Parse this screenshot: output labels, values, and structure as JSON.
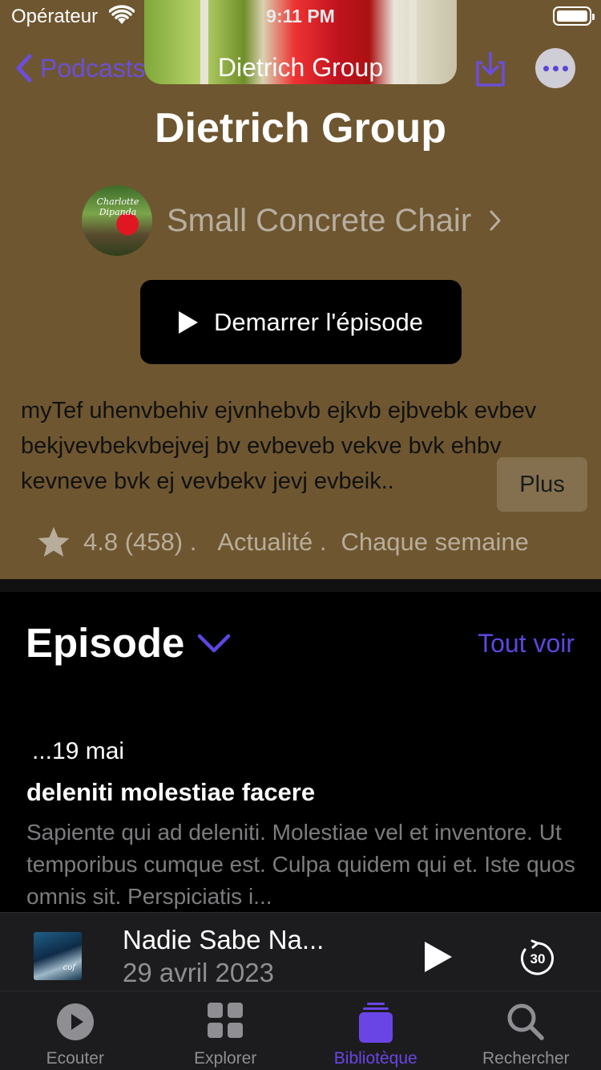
{
  "status_bar": {
    "carrier": "Opérateur",
    "time": "9:11 PM"
  },
  "nav": {
    "back_label": "Podcasts",
    "title": "Dietrich Group"
  },
  "podcast": {
    "title": "Dietrich Group",
    "author": "Small Concrete Chair",
    "avatar_script": "Charlotte Dipanda",
    "start_button": "Demarrer l'épisode",
    "description": "myTef uhenvbehiv ejvnhebvb ejkvb ejbvebk evbev bekjvevbekvbejvej bv evbeveb vekve bvk ehbv kevneve bvk ej vevbekv jevj evbeik..",
    "more_label": "Plus",
    "rating": "4.8 (458) .",
    "category": "Actualité .",
    "frequency": "Chaque semaine"
  },
  "episodes": {
    "header": "Episode",
    "see_all": "Tout voir",
    "items": [
      {
        "date": "...19 mai",
        "title": "deleniti molestiae facere",
        "description": "Sapiente qui ad deleniti. Molestiae vel et inventore. Ut temporibus cumque est. Culpa quidem qui et. Iste quos omnis sit. Perspiciatis i..."
      }
    ]
  },
  "mini_player": {
    "title": "Nadie Sabe Na...",
    "date": "29 avril 2023",
    "skip_label": "30",
    "art_script": "cof"
  },
  "tabs": [
    {
      "label": "Ecouter",
      "icon": "play-circle-icon",
      "active": false
    },
    {
      "label": "Explorer",
      "icon": "grid-icon",
      "active": false
    },
    {
      "label": "Bibliotèque",
      "icon": "library-stack-icon",
      "active": true
    },
    {
      "label": "Rechercher",
      "icon": "search-icon",
      "active": false
    }
  ],
  "colors": {
    "hero_background": "#6e5630",
    "accent": "#6b4fd8",
    "text_secondary": "#8e8e93",
    "tab_bar": "#1c1c1e"
  }
}
